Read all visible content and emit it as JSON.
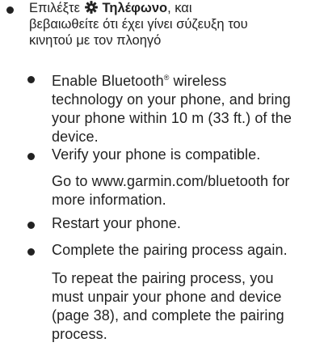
{
  "colors": {
    "text": "#222222",
    "background": "#ffffff"
  },
  "top_item": {
    "prefix": "Επιλέξτε",
    "icon": "gear-icon",
    "bold": "Τηλέφωνο",
    "suffix": ", και",
    "line2": "βεβαιωθείτε ότι έχει γίνει σύζευξη του",
    "line3": "κινητού με τον πλοηγό"
  },
  "sub_items": [
    {
      "lines": [
        "Enable Bluetooth",
        "technology on your phone, and bring",
        "your phone within 10 m (33 ft.) of the",
        "device."
      ],
      "line1_mark": "®",
      "line1_tail": " wireless"
    },
    {
      "lines": [
        "Verify your phone is compatible."
      ],
      "note": [
        "Go to www.garmin.com/bluetooth for",
        "more information."
      ]
    },
    {
      "lines": [
        "Restart your phone."
      ]
    },
    {
      "lines": [
        "Complete the pairing process again."
      ],
      "note": [
        "To repeat the pairing process, you",
        "must unpair your phone and device",
        "(page 38), and complete the pairing",
        "process."
      ]
    }
  ]
}
